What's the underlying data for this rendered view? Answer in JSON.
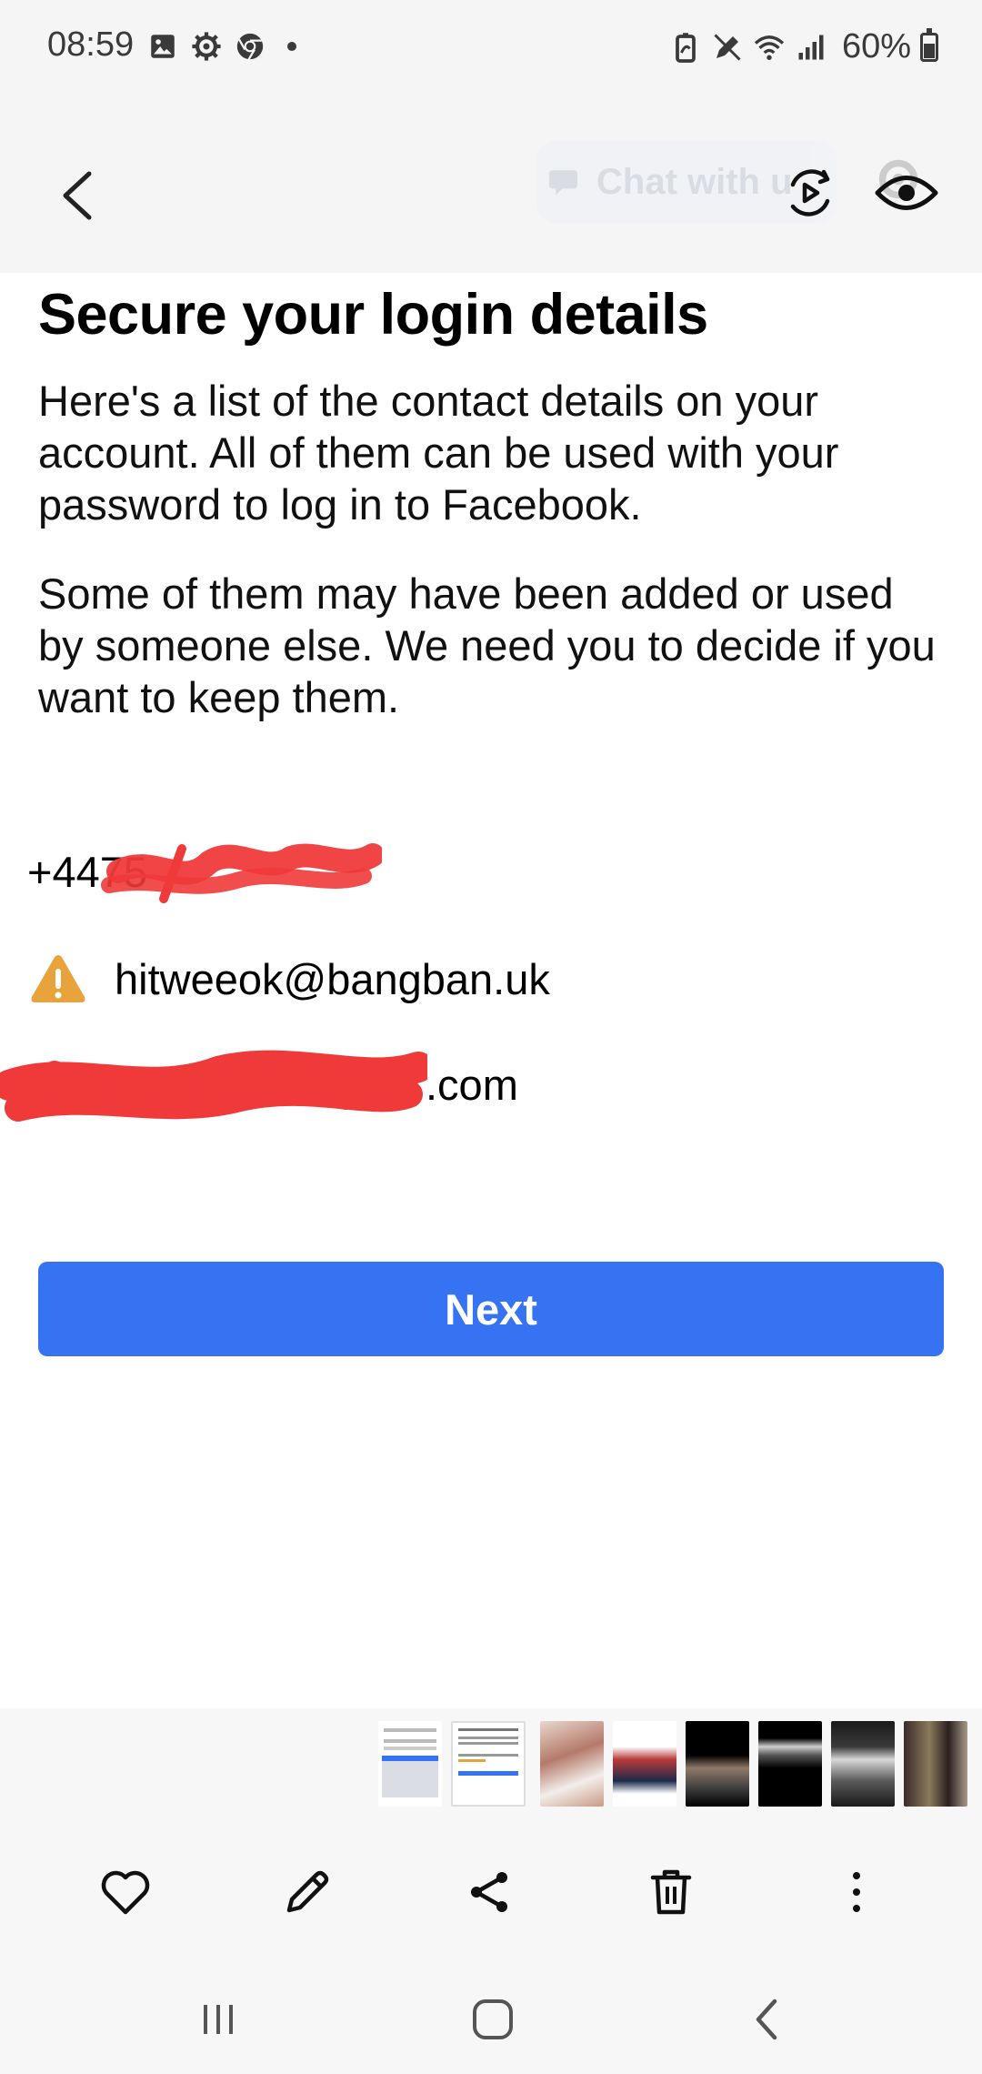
{
  "status_bar": {
    "time": "08:59",
    "battery": "60%",
    "left_icons": [
      "gallery-icon",
      "settings-icon",
      "chrome-icon",
      "dot-icon"
    ],
    "right_icons": [
      "battery-saver-icon",
      "edit-icon",
      "wifi-icon",
      "signal-icon"
    ]
  },
  "toolbar": {
    "back_icon": "chevron-left-icon",
    "chat_ghost_label": "Chat with u",
    "motion_photo_icon": "motion-photo-icon",
    "eye_icon": "eye-icon"
  },
  "content": {
    "title": "Secure your login details",
    "paragraph_1": "Here's a list of the contact details on your account. All of them can be used with your password to log in to Facebook.",
    "paragraph_2": "Some of them may have been added or used by someone else. We need you to decide if you want to keep them.",
    "contacts": [
      {
        "text": "+4475",
        "redacted": true
      },
      {
        "text": "hitweeok@bangban.uk",
        "warning": true
      },
      {
        "text": ".com",
        "redacted": true
      }
    ],
    "next_button": "Next"
  },
  "colors": {
    "accent": "#3573f2",
    "warning": "#e8a33d",
    "redaction": "#f03a3a"
  },
  "bottom_actions": [
    "heart-icon",
    "pencil-icon",
    "share-icon",
    "trash-icon",
    "more-vertical-icon"
  ],
  "nav_bar": [
    "recent-apps-icon",
    "home-icon",
    "back-icon"
  ]
}
